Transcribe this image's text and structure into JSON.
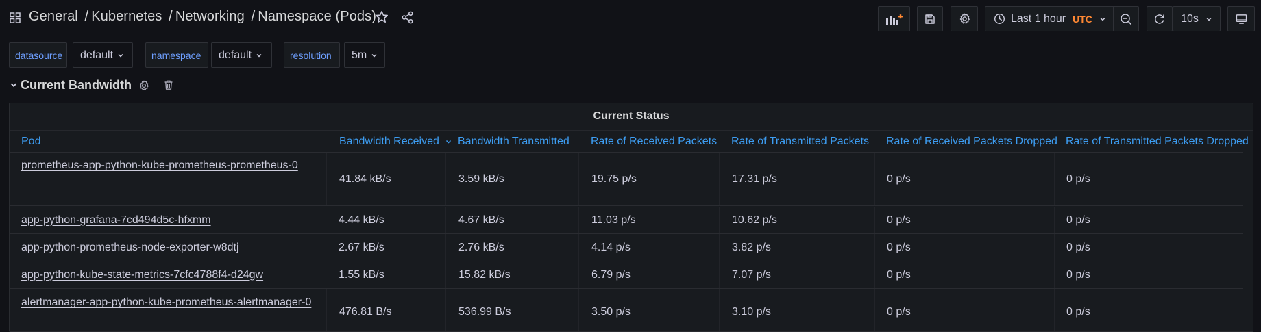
{
  "header": {
    "breadcrumb": [
      "General",
      "Kubernetes",
      "Networking",
      "Namespace (Pods)"
    ],
    "breadcrumb_separator": "/",
    "time_range": "Last 1 hour",
    "timezone": "UTC",
    "refresh_interval": "10s"
  },
  "variables": [
    {
      "label": "datasource",
      "value": "default"
    },
    {
      "label": "namespace",
      "value": "default"
    },
    {
      "label": "resolution",
      "value": "5m"
    }
  ],
  "row": {
    "title": "Current Bandwidth"
  },
  "panel": {
    "title": "Current Status",
    "columns": [
      "Pod",
      "Bandwidth Received",
      "Bandwidth Transmitted",
      "Rate of Received Packets",
      "Rate of Transmitted Packets",
      "Rate of Received Packets Dropped",
      "Rate of Transmitted Packets Dropped"
    ],
    "rows": [
      [
        "prometheus-app-python-kube-prometheus-prometheus-0",
        "41.84 kB/s",
        "3.59 kB/s",
        "19.75 p/s",
        "17.31 p/s",
        "0 p/s",
        "0 p/s"
      ],
      [
        "app-python-grafana-7cd494d5c-hfxmm",
        "4.44 kB/s",
        "4.67 kB/s",
        "11.03 p/s",
        "10.62 p/s",
        "0 p/s",
        "0 p/s"
      ],
      [
        "app-python-prometheus-node-exporter-w8dtj",
        "2.67 kB/s",
        "2.76 kB/s",
        "4.14 p/s",
        "3.82 p/s",
        "0 p/s",
        "0 p/s"
      ],
      [
        "app-python-kube-state-metrics-7cfc4788f4-d24gw",
        "1.55 kB/s",
        "15.82 kB/s",
        "6.79 p/s",
        "7.07 p/s",
        "0 p/s",
        "0 p/s"
      ],
      [
        "alertmanager-app-python-kube-prometheus-alertmanager-0",
        "476.81 B/s",
        "536.99 B/s",
        "3.50 p/s",
        "3.10 p/s",
        "0 p/s",
        "0 p/s"
      ]
    ]
  },
  "colors": {
    "background": "#111217",
    "panel": "#181b1f",
    "link_blue": "#3d9df2",
    "variable_label": "#6e9fff",
    "utc_orange": "#ff8833"
  },
  "icons": {
    "apps": "grid-icon",
    "star": "star-icon",
    "share": "share-icon",
    "add_panel": "add-panel-icon",
    "save": "save-icon",
    "settings": "gear-icon",
    "clock": "clock-icon",
    "zoom_out": "zoom-out-icon",
    "refresh": "refresh-icon",
    "tv_mode": "monitor-icon",
    "row_settings": "gear-icon",
    "row_delete": "trash-icon"
  }
}
